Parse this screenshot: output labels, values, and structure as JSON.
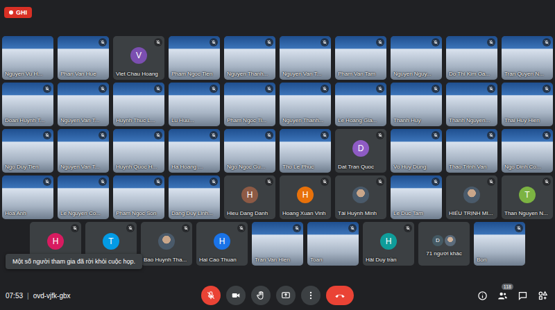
{
  "recording": {
    "label": "GHI"
  },
  "tiles": [
    {
      "name": "Nguyen Vu H...",
      "kind": "video",
      "muted": false
    },
    {
      "name": "Phan Van Hue",
      "kind": "video",
      "muted": true
    },
    {
      "name": "Viet Chau Hoang",
      "kind": "avatar",
      "initial": "V",
      "color": "#7b4fb0",
      "muted": true
    },
    {
      "name": "Pham Ngoc Tien",
      "kind": "video",
      "muted": true
    },
    {
      "name": "Nguyen Thanh...",
      "kind": "video",
      "muted": true
    },
    {
      "name": "Nguyen Van T...",
      "kind": "video",
      "muted": true
    },
    {
      "name": "Pham Van Tam",
      "kind": "video",
      "muted": true
    },
    {
      "name": "Nguyen Nguy...",
      "kind": "video",
      "muted": true
    },
    {
      "name": "Do Thi Kim Oa...",
      "kind": "video",
      "muted": true
    },
    {
      "name": "Tran Quyen N...",
      "kind": "video",
      "muted": true
    },
    {
      "name": "Doan Huynh T...",
      "kind": "video",
      "muted": true
    },
    {
      "name": "Nguyen Van T...",
      "kind": "video",
      "muted": true
    },
    {
      "name": "Huynh Thuc L...",
      "kind": "video",
      "muted": true
    },
    {
      "name": "Lu Huu...",
      "kind": "video",
      "muted": true
    },
    {
      "name": "Pham Ngoc Ti...",
      "kind": "video",
      "muted": true
    },
    {
      "name": "Nguyen Thanh...",
      "kind": "video",
      "muted": true
    },
    {
      "name": "Le Hoang Gia...",
      "kind": "video",
      "muted": true
    },
    {
      "name": "Thanh Huy",
      "kind": "video",
      "muted": true
    },
    {
      "name": "Thanh Nguyen...",
      "kind": "video",
      "muted": true
    },
    {
      "name": "Thai Huy Hien",
      "kind": "video",
      "muted": true
    },
    {
      "name": "Ngo Duy Tien",
      "kind": "video",
      "muted": true
    },
    {
      "name": "Nguyen Van T...",
      "kind": "video",
      "muted": true
    },
    {
      "name": "Huynh Quoc H...",
      "kind": "video",
      "muted": true
    },
    {
      "name": "Ha Hoang ...",
      "kind": "video",
      "muted": true
    },
    {
      "name": "Ngo Ngoc Gu...",
      "kind": "video",
      "muted": true
    },
    {
      "name": "Tho Le Phuc",
      "kind": "video",
      "muted": true
    },
    {
      "name": "Dat Tran Quoc",
      "kind": "avatar",
      "initial": "D",
      "color": "#8e5bc4",
      "muted": true
    },
    {
      "name": "Vo Huy Dung",
      "kind": "video",
      "muted": true
    },
    {
      "name": "Thao Trinh Van",
      "kind": "video",
      "muted": true
    },
    {
      "name": "Ngo Dinh Co...",
      "kind": "video",
      "muted": true
    },
    {
      "name": "Hoa Anh",
      "kind": "video",
      "muted": true
    },
    {
      "name": "Le Nguyen Co...",
      "kind": "video",
      "muted": true
    },
    {
      "name": "Pham Ngoc Son",
      "kind": "video",
      "muted": true
    },
    {
      "name": "Dang Duy Linh...",
      "kind": "video",
      "muted": true
    },
    {
      "name": "Hieu Dang Danh",
      "kind": "avatar",
      "initial": "H",
      "color": "#8d5a45",
      "muted": true
    },
    {
      "name": "Hoang Xuan Vinh",
      "kind": "avatar",
      "initial": "H",
      "color": "#e8710a",
      "muted": true
    },
    {
      "name": "Tài Huỳnh Minh",
      "kind": "photo",
      "muted": true
    },
    {
      "name": "Le Duc Tam",
      "kind": "video",
      "muted": true
    },
    {
      "name": "HIẾU TRỊNH MI...",
      "kind": "photo",
      "muted": true
    },
    {
      "name": "Than Nguyen N...",
      "kind": "avatar",
      "initial": "T",
      "color": "#7cb342",
      "muted": true
    },
    {
      "kind": "avatar",
      "initial": "H",
      "color": "#d81b60",
      "muted": true
    },
    {
      "kind": "avatar",
      "initial": "T",
      "color": "#039be5",
      "muted": true
    },
    {
      "name": "Bao Huynh Tha...",
      "kind": "photo",
      "muted": true
    },
    {
      "name": "Hai Cao Thuan",
      "kind": "avatar",
      "initial": "H",
      "color": "#1a73e8",
      "muted": true
    },
    {
      "name": "Tran Van Hien",
      "kind": "video",
      "muted": true
    },
    {
      "name": "Toan",
      "kind": "video",
      "muted": true
    },
    {
      "name": "Hải Duy trần",
      "kind": "avatar",
      "initial": "H",
      "color": "#0f9d9a",
      "muted": true
    },
    {
      "name": "71 người khác",
      "kind": "others",
      "initial": "D",
      "color": "#455a64",
      "muted": false
    },
    {
      "name": "Bon",
      "kind": "video",
      "muted": true
    }
  ],
  "toast": "Một số người tham gia đã rời khỏi cuộc họp.",
  "footer": {
    "time": "07:53",
    "separator": "|",
    "meeting_code": "ovd-vjfk-gbx"
  },
  "controls": [
    {
      "kind": "mic",
      "on": false
    },
    {
      "kind": "camera",
      "on": true
    },
    {
      "kind": "hand",
      "on": false
    },
    {
      "kind": "present",
      "on": false
    },
    {
      "kind": "more",
      "on": false
    },
    {
      "kind": "leave",
      "on": false
    }
  ],
  "side_buttons": [
    {
      "kind": "info"
    },
    {
      "kind": "people",
      "badge": "118"
    },
    {
      "kind": "chat"
    },
    {
      "kind": "activities"
    }
  ]
}
